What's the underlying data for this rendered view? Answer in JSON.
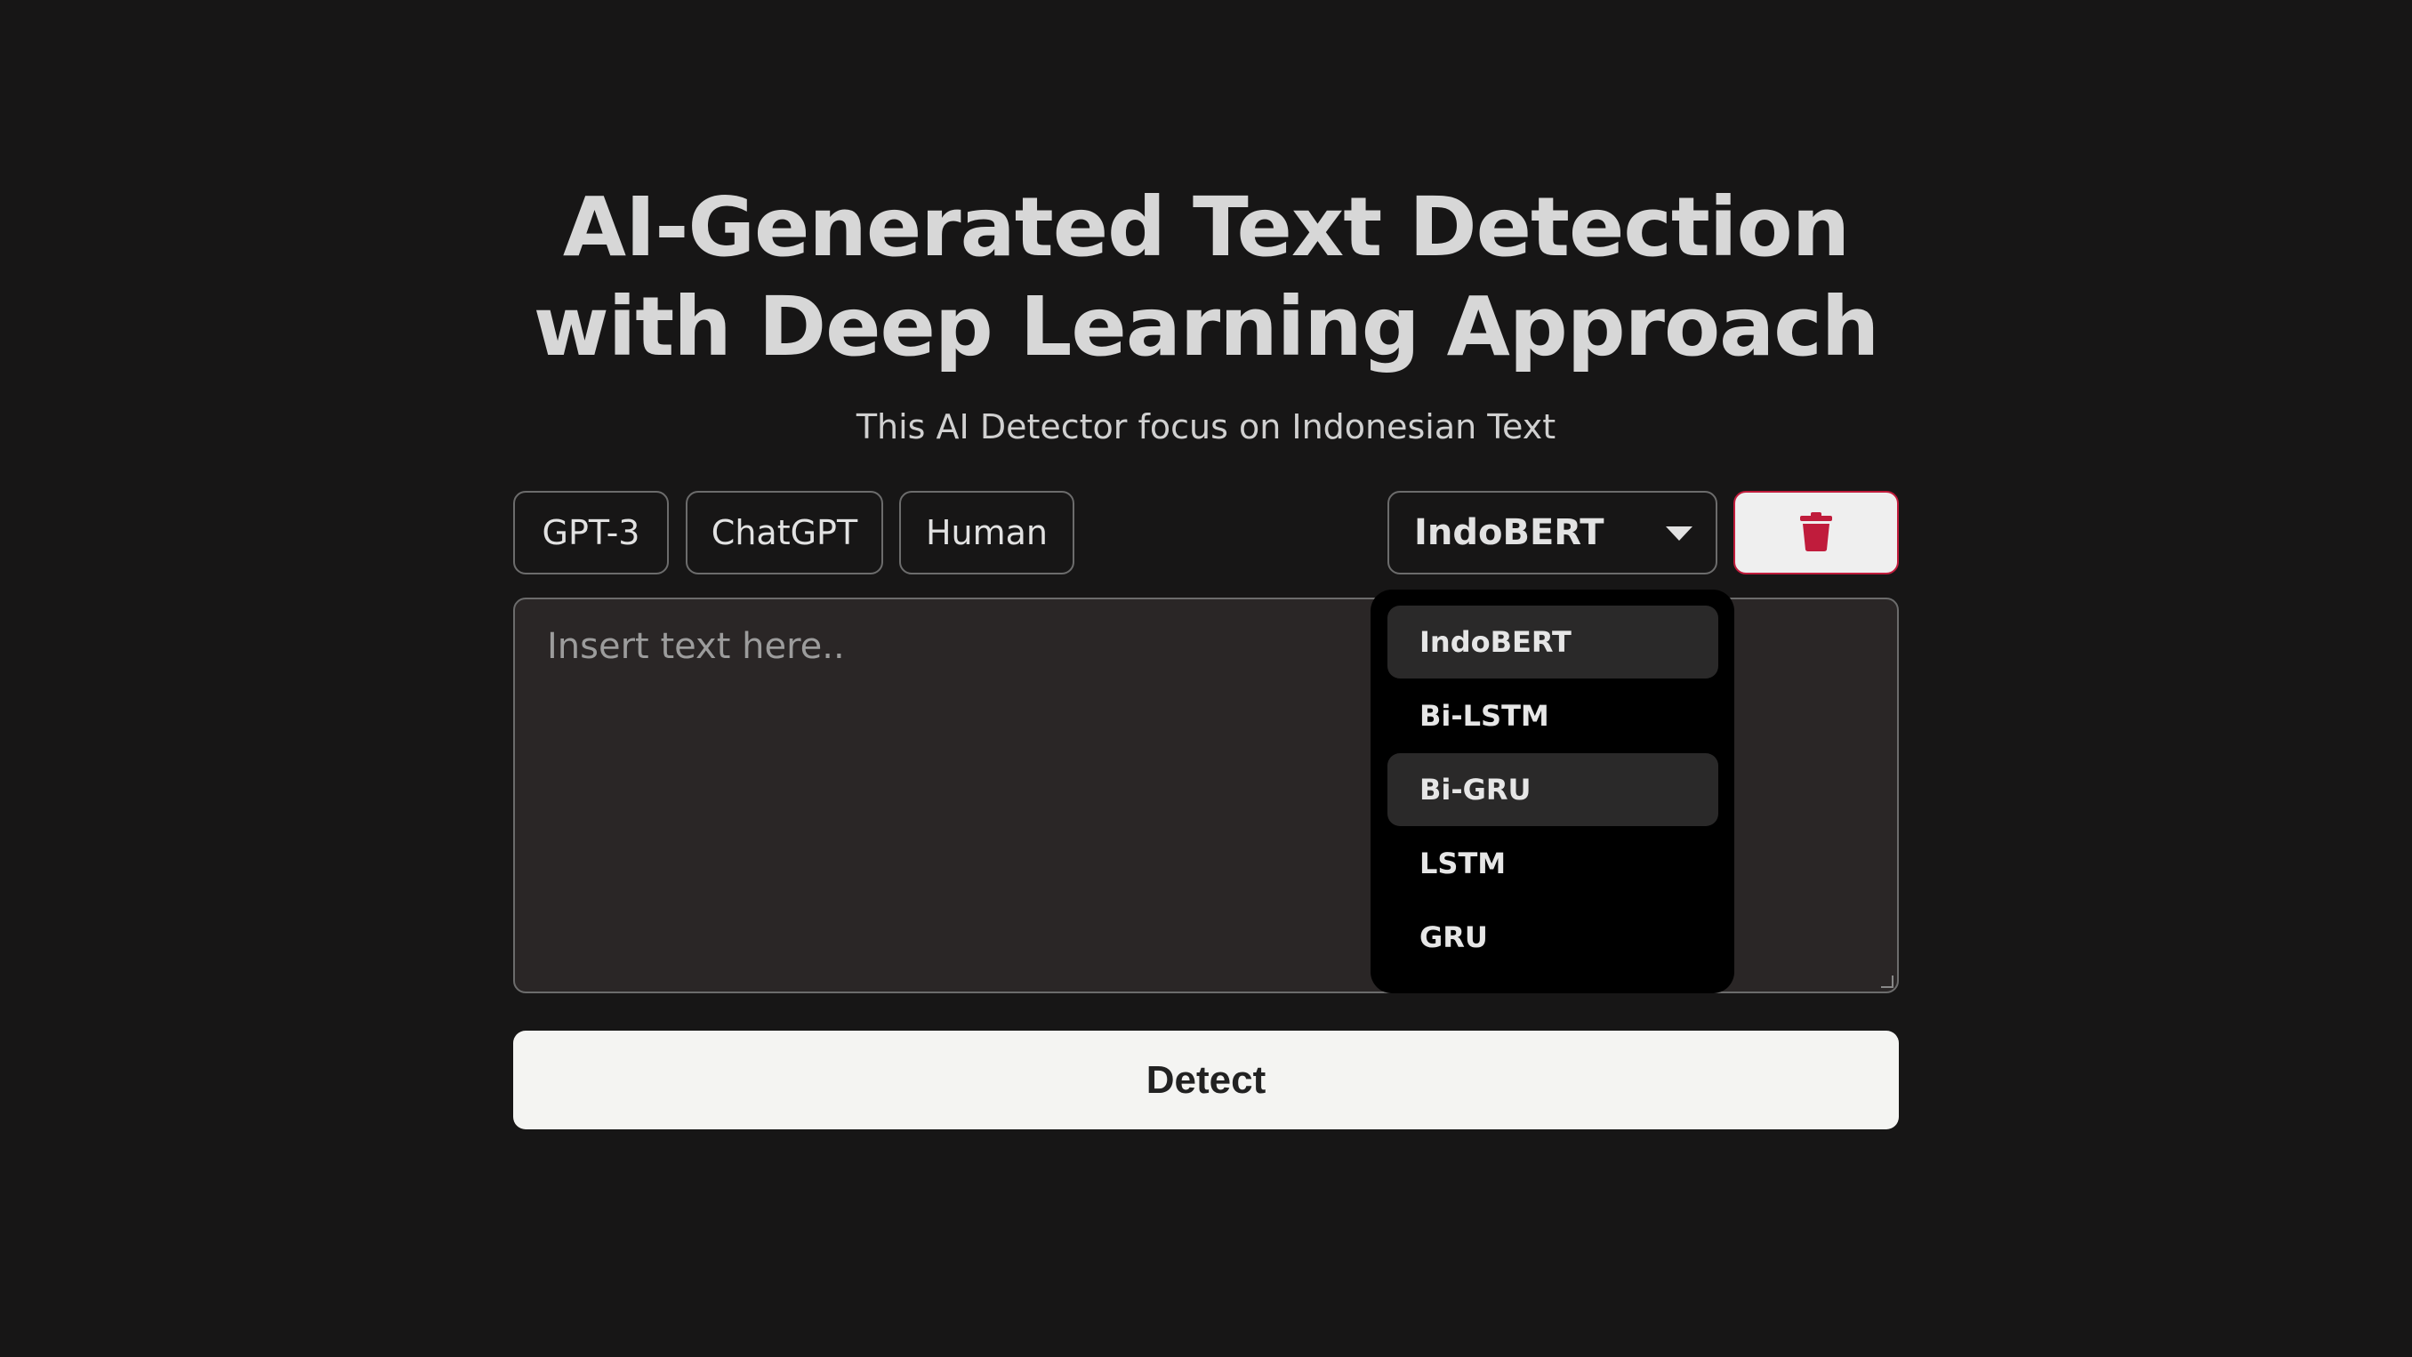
{
  "header": {
    "title_line1": "AI-Generated Text Detection",
    "title_line2": "with Deep Learning Approach",
    "subtitle": "This AI Detector focus on Indonesian Text"
  },
  "sample_buttons": [
    {
      "label": "GPT-3"
    },
    {
      "label": "ChatGPT"
    },
    {
      "label": "Human"
    }
  ],
  "model_select": {
    "selected": "IndoBERT",
    "options": [
      "IndoBERT",
      "Bi-LSTM",
      "Bi-GRU",
      "LSTM",
      "GRU"
    ],
    "hovered_option": "Bi-GRU"
  },
  "clear_button": {
    "icon": "trash-icon",
    "color": "#c01c3c"
  },
  "input": {
    "placeholder": "Insert text here..",
    "value": ""
  },
  "detect_button": {
    "label": "Detect"
  }
}
